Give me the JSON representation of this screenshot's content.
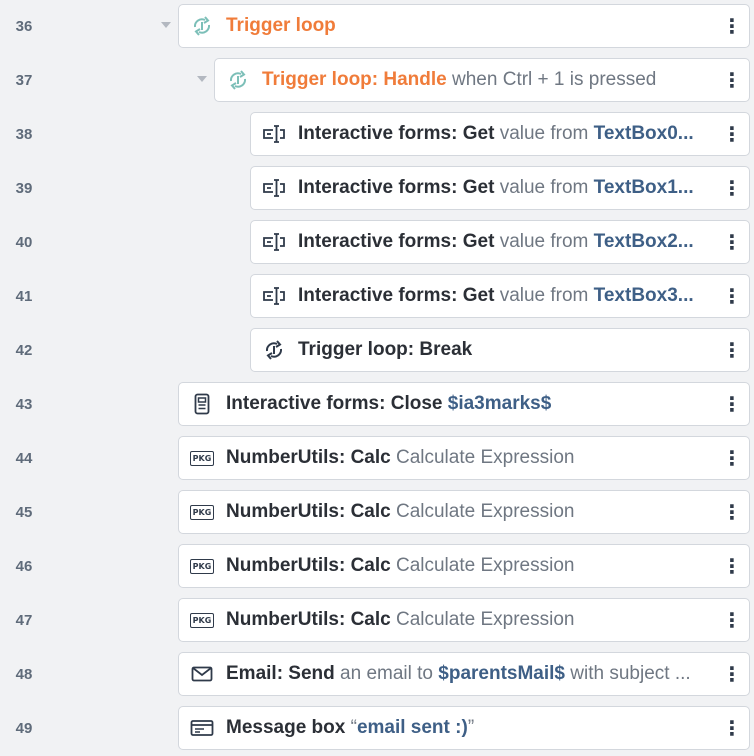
{
  "rows": [
    {
      "line": "36",
      "title": "Trigger loop",
      "title_color": "#f07c3a",
      "desc": "",
      "icon": "trigger-loop-icon",
      "collapsible": true
    },
    {
      "line": "37",
      "title": "Trigger loop: Handle",
      "title_color": "#f07c3a",
      "desc": "when Ctrl + 1 is pressed",
      "icon": "trigger-loop-icon",
      "collapsible": true
    },
    {
      "line": "38",
      "title": "Interactive forms: Get",
      "desc": "value from",
      "var": "TextBox0...",
      "icon": "form-field-icon"
    },
    {
      "line": "39",
      "title": "Interactive forms: Get",
      "desc": "value from",
      "var": "TextBox1...",
      "icon": "form-field-icon"
    },
    {
      "line": "40",
      "title": "Interactive forms: Get",
      "desc": "value from",
      "var": "TextBox2...",
      "icon": "form-field-icon"
    },
    {
      "line": "41",
      "title": "Interactive forms: Get",
      "desc": "value from",
      "var": "TextBox3...",
      "icon": "form-field-icon"
    },
    {
      "line": "42",
      "title": "Trigger loop: Break",
      "desc": "",
      "icon": "trigger-loop-break-icon"
    },
    {
      "line": "43",
      "title": "Interactive forms: Close",
      "desc": "",
      "var": "$ia3marks$",
      "icon": "form-document-icon"
    },
    {
      "line": "44",
      "title": "NumberUtils: Calc",
      "desc": "Calculate Expression",
      "icon": "pkg-icon",
      "icon_text": "PKG"
    },
    {
      "line": "45",
      "title": "NumberUtils: Calc",
      "desc": "Calculate Expression",
      "icon": "pkg-icon",
      "icon_text": "PKG"
    },
    {
      "line": "46",
      "title": "NumberUtils: Calc",
      "desc": "Calculate Expression",
      "icon": "pkg-icon",
      "icon_text": "PKG"
    },
    {
      "line": "47",
      "title": "NumberUtils: Calc",
      "desc": "Calculate Expression",
      "icon": "pkg-icon",
      "icon_text": "PKG"
    },
    {
      "line": "48",
      "title": "Email: Send",
      "desc": "an email to",
      "var": "$parentsMail$",
      "desc2": "with subject ...",
      "icon": "envelope-icon"
    },
    {
      "line": "49",
      "title": "Message box",
      "quote_open": "“",
      "var": "email sent :)",
      "quote_close": "”",
      "icon": "message-box-icon"
    }
  ],
  "menu_glyph": "⋮"
}
